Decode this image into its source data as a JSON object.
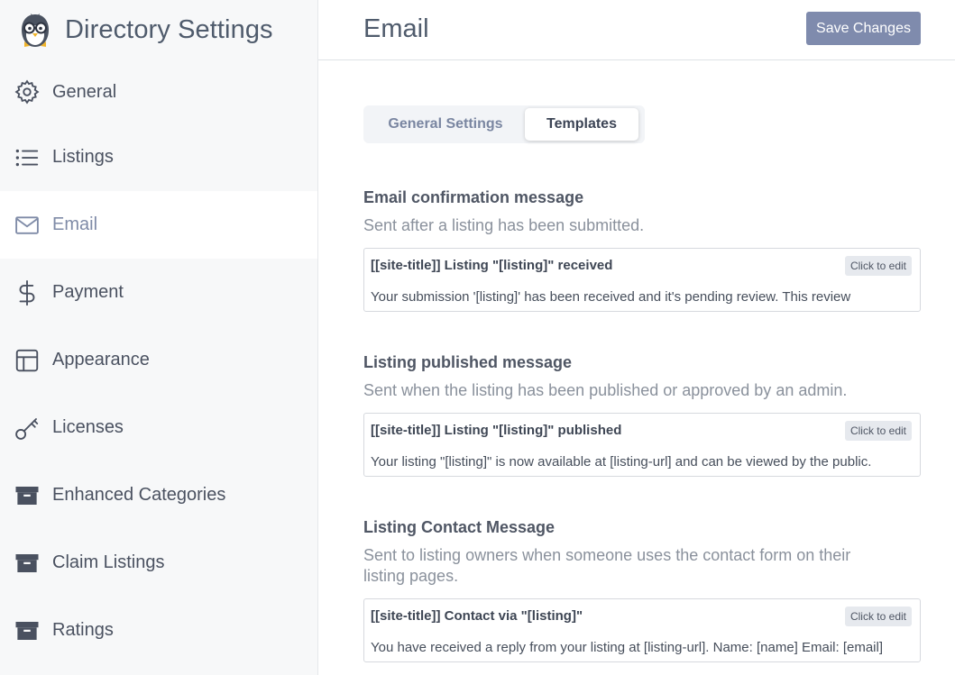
{
  "brand": {
    "title": "Directory Settings"
  },
  "sidebar": {
    "items": [
      {
        "label": "General",
        "icon": "gear-icon"
      },
      {
        "label": "Listings",
        "icon": "list-icon"
      },
      {
        "label": "Email",
        "icon": "envelope-icon",
        "active": true
      },
      {
        "label": "Payment",
        "icon": "dollar-icon"
      },
      {
        "label": "Appearance",
        "icon": "layout-icon"
      },
      {
        "label": "Licenses",
        "icon": "key-icon"
      },
      {
        "label": "Enhanced Categories",
        "icon": "archive-icon"
      },
      {
        "label": "Claim Listings",
        "icon": "archive-icon"
      },
      {
        "label": "Ratings",
        "icon": "archive-icon"
      }
    ]
  },
  "header": {
    "title": "Email",
    "save_label": "Save Changes"
  },
  "tabs": {
    "general": "General Settings",
    "templates": "Templates",
    "active": "Templates"
  },
  "templates": [
    {
      "title": "Email confirmation message",
      "description": "Sent after a listing has been submitted.",
      "subject": "[[site-title]] Listing \"[listing]\" received",
      "body": "Your submission '[listing]' has been received and it's pending review. This review",
      "edit_label": "Click to edit"
    },
    {
      "title": "Listing published message",
      "description": "Sent when the listing has been published or approved by an admin.",
      "subject": "[[site-title]] Listing \"[listing]\" published",
      "body": "Your listing \"[listing]\" is now available at [listing-url] and can be viewed by the public.",
      "edit_label": "Click to edit"
    },
    {
      "title": "Listing Contact Message",
      "description": "Sent to listing owners when someone uses the contact form on their listing pages.",
      "subject": "[[site-title]] Contact via \"[listing]\"",
      "body": "You have received a reply from your listing at [listing-url]. Name: [name] Email: [email]",
      "edit_label": "Click to edit"
    }
  ],
  "colors": {
    "accent": "#7f8bad",
    "sidebar_bg": "#f7f8f9",
    "active_text": "#7f8ba7"
  }
}
